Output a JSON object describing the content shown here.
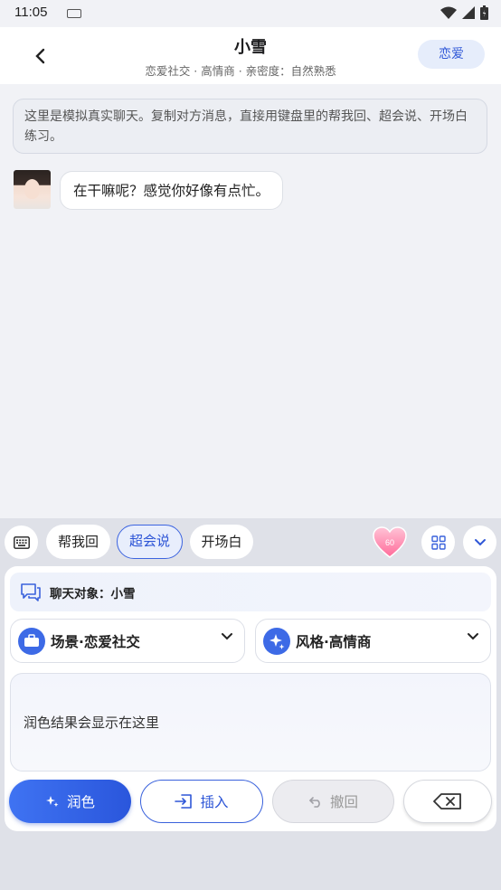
{
  "status_bar": {
    "time": "11:05"
  },
  "header": {
    "title": "小雪",
    "subtitle": "恋爱社交 · 高情商 · 亲密度：自然熟悉",
    "mode_button": "恋爱"
  },
  "chat": {
    "notice": "这里是模拟真实聊天。复制对方消息，直接用键盘里的帮我回、超会说、开场白练习。",
    "messages": [
      {
        "sender": "小雪",
        "text": "在干嘛呢？感觉你好像有点忙。"
      }
    ]
  },
  "keyboard": {
    "tabs": [
      {
        "label": "帮我回",
        "active": false
      },
      {
        "label": "超会说",
        "active": true
      },
      {
        "label": "开场白",
        "active": false
      }
    ],
    "heart_badge": "60",
    "chat_target": "聊天对象：小雪",
    "scene_select": "场景·恋爱社交",
    "style_select": "风格·高情商",
    "result_placeholder": "润色结果会显示在这里",
    "buttons": {
      "polish": "润色",
      "insert": "插入",
      "undo": "撤回"
    }
  },
  "colors": {
    "accent": "#2f57d7",
    "background": "#f1f2f6",
    "panel": "#dfe1e8"
  }
}
